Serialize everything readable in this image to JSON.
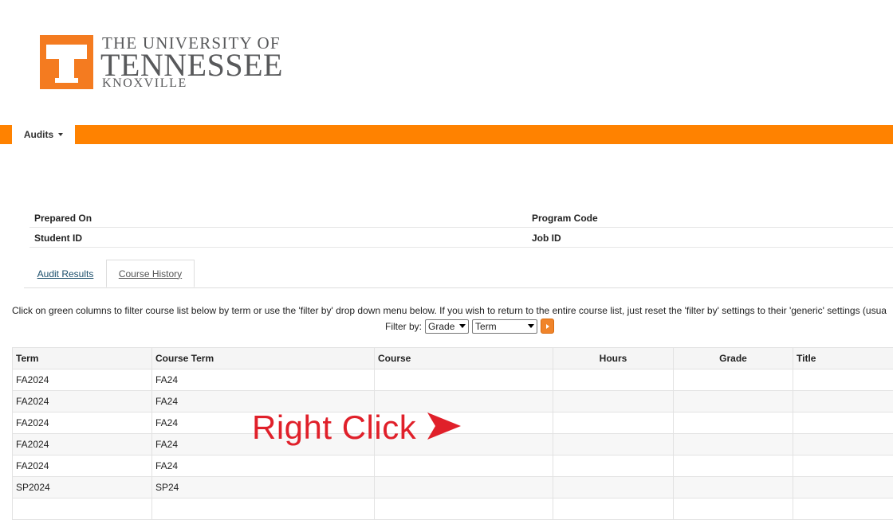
{
  "logo": {
    "letter": "T",
    "line1": "THE UNIVERSITY OF",
    "line2": "TENNESSEE",
    "line3": "KNOXVILLE"
  },
  "nav": {
    "audits_label": "Audits"
  },
  "info": {
    "prepared_on": "Prepared On",
    "program_code": "Program Code",
    "student_id": "Student ID",
    "job_id": "Job ID"
  },
  "tabs": {
    "audit_results": "Audit Results",
    "course_history": "Course History"
  },
  "instructions": "Click on green columns to filter course list below by term or use the 'filter by' drop down menu below. If you wish to return to the entire course list, just reset the 'filter by' settings to their 'generic' settings (usua",
  "filter": {
    "label": "Filter by:",
    "grade_value": "Grade",
    "term_value": "Term"
  },
  "table": {
    "headers": [
      "Term",
      "Course Term",
      "Course",
      "Hours",
      "Grade",
      "Title"
    ],
    "rows": [
      [
        "FA2024",
        "FA24",
        "",
        "",
        "",
        ""
      ],
      [
        "FA2024",
        "FA24",
        "",
        "",
        "",
        ""
      ],
      [
        "FA2024",
        "FA24",
        "",
        "",
        "",
        ""
      ],
      [
        "FA2024",
        "FA24",
        "",
        "",
        "",
        ""
      ],
      [
        "FA2024",
        "FA24",
        "",
        "",
        "",
        ""
      ],
      [
        "SP2024",
        "SP24",
        "",
        "",
        "",
        ""
      ]
    ]
  },
  "annotation": {
    "text": "Right Click",
    "color": "#e0202a"
  },
  "colors": {
    "brand_orange": "#ff8200",
    "logo_orange": "#f47b20"
  }
}
